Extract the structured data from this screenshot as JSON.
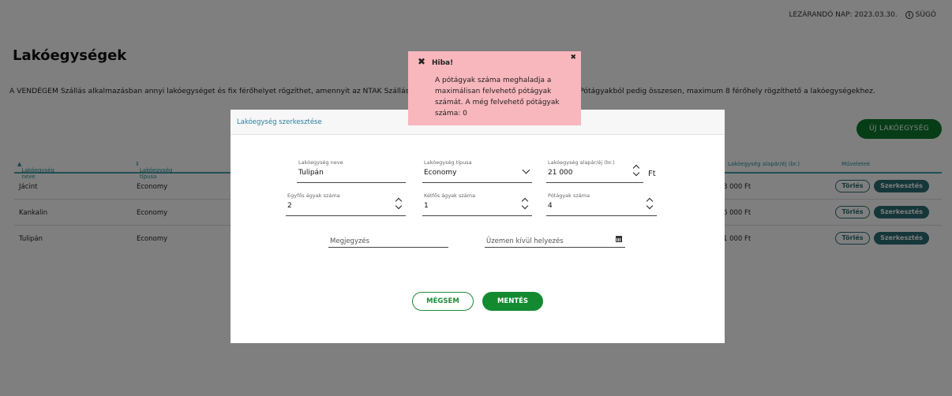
{
  "topbar": {
    "closing_day": "LEZÁRANDÓ NAP: 2023.03.30.",
    "help": "SÚGÓ"
  },
  "page": {
    "title": "Lakóegységek",
    "intro_left": "A VENDÉGEM Szállás alkalmazásban annyi lakóegységet és fix férőhelyet rögzíthet, amennyit az NTAK Szállás",
    "intro_right": ". Pótágyakból pedig összesen, maximum 8 férőhely rögzíthető a lakóegységekhez.",
    "new_button": "ÚJ LAKÓEGYSÉG"
  },
  "table": {
    "headers": {
      "name": "Lakóegység neve",
      "type": "Lakóegység típusa",
      "price": "Lakóegység alapár/éj (br.)",
      "actions": "Műveletek"
    },
    "rows": [
      {
        "name": "Jácint",
        "type": "Economy",
        "price": "8 000 Ft"
      },
      {
        "name": "Kankalin",
        "type": "Economy",
        "price": "6 000 Ft"
      },
      {
        "name": "Tulipán",
        "type": "Economy",
        "price": "1 000 Ft"
      }
    ],
    "delete_label": "Törlés",
    "edit_label": "Szerkesztés"
  },
  "modal": {
    "title": "Lakóegység szerkesztése",
    "fields": {
      "name": {
        "label": "Lakóegység neve",
        "value": "Tulipán"
      },
      "type": {
        "label": "Lakóegység típusa",
        "value": "Economy"
      },
      "price": {
        "label": "Lakóegység alapár/éj (br.)",
        "value": "21 000",
        "unit": "Ft"
      },
      "single_beds": {
        "label": "Egyfős ágyak száma",
        "value": "2"
      },
      "double_beds": {
        "label": "Kétfős ágyak száma",
        "value": "1"
      },
      "extra_beds": {
        "label": "Pótágyak száma",
        "value": "4"
      },
      "note": {
        "placeholder": "Megjegyzés"
      },
      "out_of_service": {
        "placeholder": "Üzemen kívül helyezés"
      }
    },
    "cancel_label": "MÉGSEM",
    "save_label": "MENTÉS"
  },
  "toast": {
    "title": "Hiba!",
    "message": "A pótágyak száma meghaladja a maximálisan felvehető pótágyak számát. A még felvehető pótágyak száma: 0"
  },
  "colors": {
    "primary_green": "#138a30",
    "teal": "#2a6f75",
    "toast_bg": "#f8b7bd"
  }
}
